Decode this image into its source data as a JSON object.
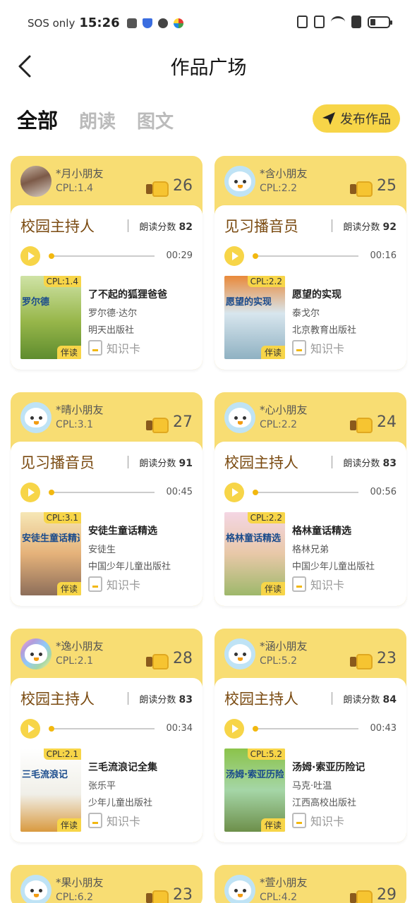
{
  "status": {
    "sos": "SOS only",
    "time": "15:26"
  },
  "header": {
    "title": "作品广场"
  },
  "tabs": [
    {
      "label": "全部",
      "active": true
    },
    {
      "label": "朗读",
      "active": false
    },
    {
      "label": "图文",
      "active": false
    }
  ],
  "publish_label": "发布作品",
  "works": [
    {
      "name": "*月小朋友",
      "cpl": "CPL:1.4",
      "likes": "26",
      "role": "校园主持人",
      "score_label": "朗读分数",
      "score": "82",
      "duration": "00:29",
      "book_cpl": "CPL:1.4",
      "book_tag": "伴读",
      "cover_text": "罗尔德",
      "book_title": "了不起的狐狸爸爸",
      "author": "罗尔德·达尔",
      "publisher": "明天出版社",
      "knowledge": "知识卡"
    },
    {
      "name": "*含小朋友",
      "cpl": "CPL:2.2",
      "likes": "25",
      "role": "见习播音员",
      "score_label": "朗读分数",
      "score": "92",
      "duration": "00:16",
      "book_cpl": "CPL:2.2",
      "book_tag": "伴读",
      "cover_text": "愿望的实现",
      "book_title": "愿望的实现",
      "author": "泰戈尔",
      "publisher": "北京教育出版社",
      "knowledge": "知识卡"
    },
    {
      "name": "*晴小朋友",
      "cpl": "CPL:3.1",
      "likes": "27",
      "role": "见习播音员",
      "score_label": "朗读分数",
      "score": "91",
      "duration": "00:45",
      "book_cpl": "CPL:3.1",
      "book_tag": "伴读",
      "cover_text": "安徒生童话精选",
      "book_title": "安徒生童话精选",
      "author": "安徒生",
      "publisher": "中国少年儿童出版社",
      "knowledge": "知识卡"
    },
    {
      "name": "*心小朋友",
      "cpl": "CPL:2.2",
      "likes": "24",
      "role": "校园主持人",
      "score_label": "朗读分数",
      "score": "83",
      "duration": "00:56",
      "book_cpl": "CPL:2.2",
      "book_tag": "伴读",
      "cover_text": "格林童话精选",
      "book_title": "格林童话精选",
      "author": "格林兄弟",
      "publisher": "中国少年儿童出版社",
      "knowledge": "知识卡"
    },
    {
      "name": "*逸小朋友",
      "cpl": "CPL:2.1",
      "likes": "28",
      "role": "校园主持人",
      "score_label": "朗读分数",
      "score": "83",
      "duration": "00:34",
      "book_cpl": "CPL:2.1",
      "book_tag": "伴读",
      "cover_text": "三毛流浪记",
      "book_title": "三毛流浪记全集",
      "author": "张乐平",
      "publisher": "少年儿童出版社",
      "knowledge": "知识卡"
    },
    {
      "name": "*涵小朋友",
      "cpl": "CPL:5.2",
      "likes": "23",
      "role": "校园主持人",
      "score_label": "朗读分数",
      "score": "84",
      "duration": "00:43",
      "book_cpl": "CPL:5.2",
      "book_tag": "伴读",
      "cover_text": "汤姆·索亚历险记",
      "book_title": "汤姆·索亚历险记",
      "author": "马克·吐温",
      "publisher": "江西高校出版社",
      "knowledge": "知识卡"
    },
    {
      "name": "*果小朋友",
      "cpl": "CPL:6.2",
      "likes": "23"
    },
    {
      "name": "*萱小朋友",
      "cpl": "CPL:4.2",
      "likes": "29"
    }
  ]
}
